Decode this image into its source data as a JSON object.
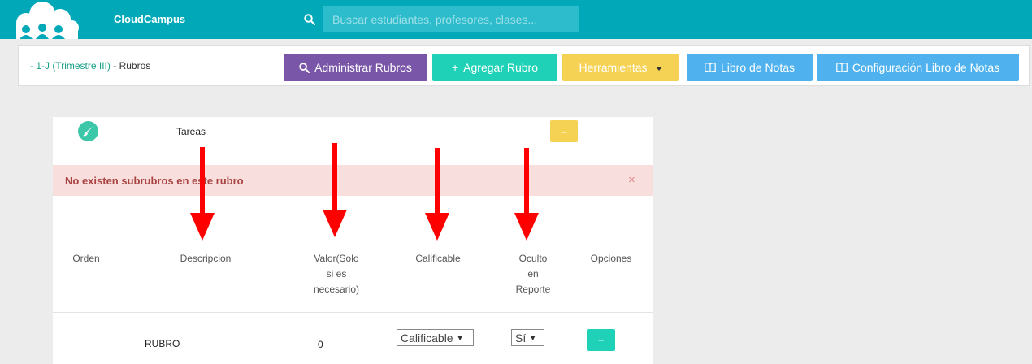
{
  "app": {
    "brand": "CloudCampus"
  },
  "search": {
    "placeholder": "Buscar estudiantes, profesores, clases..."
  },
  "breadcrumb": {
    "link": "- 1-J (Trimestre III)",
    "separator": " - ",
    "current": "Rubros"
  },
  "toolbar": {
    "administrar": "Administrar Rubros",
    "agregar": "Agregar Rubro",
    "herramientas": "Herramientas",
    "libro_notas": "Libro de Notas",
    "configuracion": "Configuración Libro de Notas"
  },
  "rubro": {
    "name": "Tareas",
    "collapse_label": "–"
  },
  "alert": {
    "message": "No existen subrubros en este rubro",
    "close": "×"
  },
  "table": {
    "headers": {
      "orden": [
        "Orden"
      ],
      "descripcion": [
        "Descripcion"
      ],
      "valor": [
        "Valor(Solo",
        "si es",
        "necesario)"
      ],
      "calificable": [
        "Calificable"
      ],
      "oculto": [
        "Oculto",
        "en",
        "Reporte"
      ],
      "opciones": [
        "Opciones"
      ]
    },
    "row": {
      "descripcion": "RUBRO",
      "valor": "0",
      "calificable": "Calificable",
      "oculto": "Sí",
      "add_label": "+"
    }
  },
  "colors": {
    "topbar": "#00a8b8",
    "purple": "#7a56a8",
    "teal": "#1fd1b6",
    "yellow": "#f5d253",
    "blue": "#4fb2ee",
    "alert_bg": "#f9dede",
    "alert_text": "#a94442",
    "arrow": "#ff0000"
  },
  "icons": [
    "cloud-logo-icon",
    "search-icon",
    "book-icon",
    "paintbrush-icon",
    "caret-down-icon",
    "close-icon"
  ]
}
